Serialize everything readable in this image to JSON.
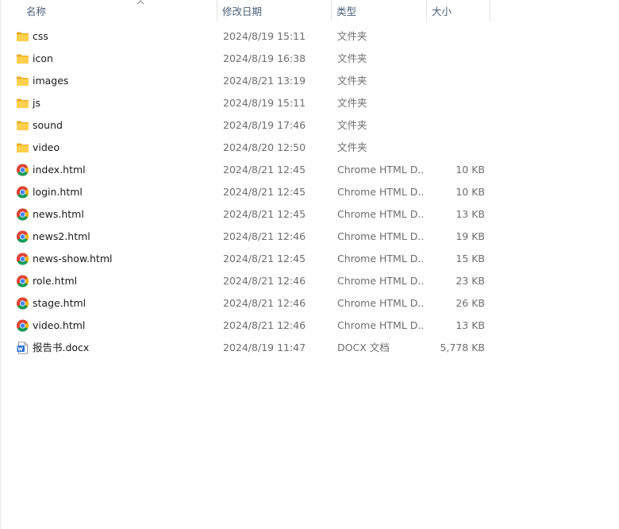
{
  "columns": {
    "name": "名称",
    "date": "修改日期",
    "type": "类型",
    "size": "大小"
  },
  "sort": {
    "column": "name",
    "direction": "ascending",
    "icon": "sort-up-icon"
  },
  "files": [
    {
      "name": "css",
      "date": "2024/8/19 15:11",
      "type": "文件夹",
      "size": "",
      "icon": "folder-icon"
    },
    {
      "name": "icon",
      "date": "2024/8/19 16:38",
      "type": "文件夹",
      "size": "",
      "icon": "folder-icon"
    },
    {
      "name": "images",
      "date": "2024/8/21 13:19",
      "type": "文件夹",
      "size": "",
      "icon": "folder-icon"
    },
    {
      "name": "js",
      "date": "2024/8/19 15:11",
      "type": "文件夹",
      "size": "",
      "icon": "folder-icon"
    },
    {
      "name": "sound",
      "date": "2024/8/19 17:46",
      "type": "文件夹",
      "size": "",
      "icon": "folder-icon"
    },
    {
      "name": "video",
      "date": "2024/8/20 12:50",
      "type": "文件夹",
      "size": "",
      "icon": "folder-icon"
    },
    {
      "name": "index.html",
      "date": "2024/8/21 12:45",
      "type": "Chrome HTML D...",
      "size": "10 KB",
      "icon": "chrome-icon"
    },
    {
      "name": "login.html",
      "date": "2024/8/21 12:45",
      "type": "Chrome HTML D...",
      "size": "10 KB",
      "icon": "chrome-icon"
    },
    {
      "name": "news.html",
      "date": "2024/8/21 12:45",
      "type": "Chrome HTML D...",
      "size": "13 KB",
      "icon": "chrome-icon"
    },
    {
      "name": "news2.html",
      "date": "2024/8/21 12:46",
      "type": "Chrome HTML D...",
      "size": "19 KB",
      "icon": "chrome-icon"
    },
    {
      "name": "news-show.html",
      "date": "2024/8/21 12:45",
      "type": "Chrome HTML D...",
      "size": "15 KB",
      "icon": "chrome-icon"
    },
    {
      "name": "role.html",
      "date": "2024/8/21 12:46",
      "type": "Chrome HTML D...",
      "size": "23 KB",
      "icon": "chrome-icon"
    },
    {
      "name": "stage.html",
      "date": "2024/8/21 12:46",
      "type": "Chrome HTML D...",
      "size": "26 KB",
      "icon": "chrome-icon"
    },
    {
      "name": "video.html",
      "date": "2024/8/21 12:46",
      "type": "Chrome HTML D...",
      "size": "13 KB",
      "icon": "chrome-icon"
    },
    {
      "name": "报告书.docx",
      "date": "2024/8/19 11:47",
      "type": "DOCX 文档",
      "size": "5,778 KB",
      "icon": "word-doc-icon"
    }
  ],
  "colors": {
    "header_text": "#4c607a",
    "folder": "#f8c83c",
    "word_blue": "#2b6fd6"
  }
}
